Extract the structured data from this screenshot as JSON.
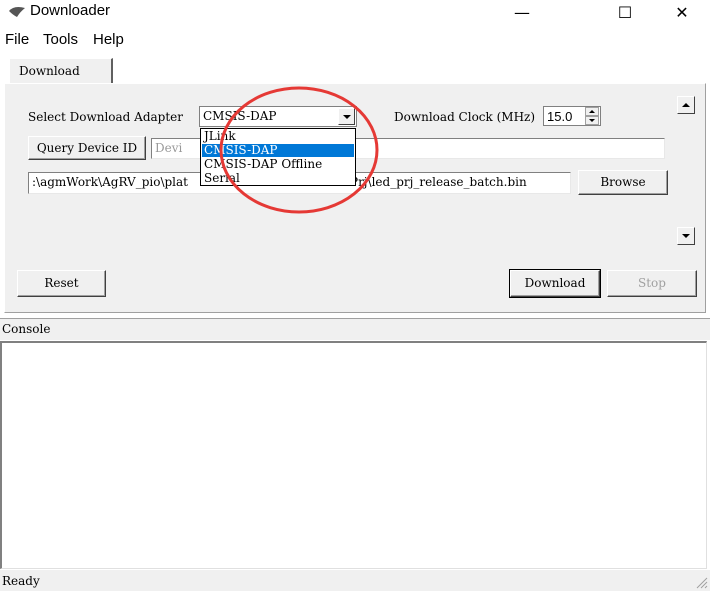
{
  "window": {
    "title": "Downloader"
  },
  "window_buttons": {
    "minimize": "—",
    "maximize": "☐",
    "close": "✕"
  },
  "menu": {
    "items": [
      "File",
      "Tools",
      "Help"
    ]
  },
  "tabs": [
    {
      "label": "Download"
    }
  ],
  "adapter": {
    "label": "Select Download Adapter",
    "selected": "CMSIS-DAP",
    "options": [
      "JLink",
      "CMSIS-DAP",
      "CMSIS-DAP Offline",
      "Serial"
    ]
  },
  "clock": {
    "label": "Download Clock (MHz)",
    "value": "15.0"
  },
  "query": {
    "button": "Query Device ID",
    "field_placeholder": "Devi"
  },
  "file": {
    "path_visible_left": ":\\agmWork\\AgRV_pio\\plat",
    "path_visible_right": "Prj\\led_prj_release_batch.bin",
    "browse": "Browse"
  },
  "buttons": {
    "reset": "Reset",
    "download": "Download",
    "stop": "Stop"
  },
  "console": {
    "label": "Console"
  },
  "status": {
    "text": "Ready"
  },
  "colors": {
    "selection": "#0078d7",
    "annotation": "#e53935",
    "panel": "#f0f0f0"
  },
  "icons": [
    "app-icon",
    "scroll-up-icon",
    "scroll-down-icon",
    "dropdown-arrow-icon",
    "resize-grip-icon"
  ]
}
